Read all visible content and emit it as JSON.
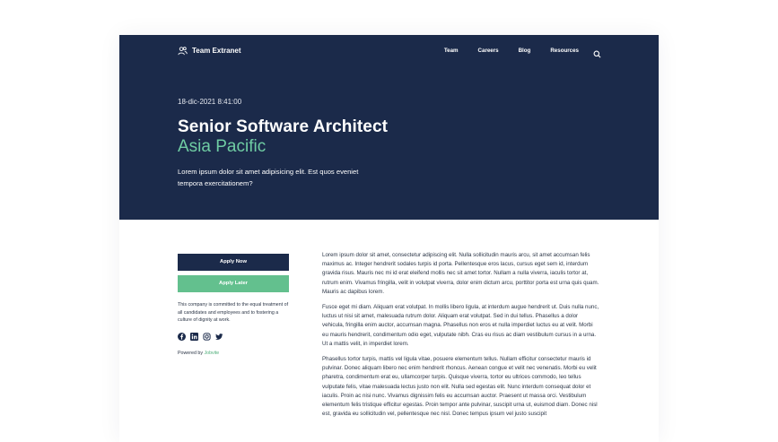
{
  "header": {
    "brand": "Team Extranet",
    "nav": [
      "Team",
      "Careers",
      "Blog",
      "Resources"
    ],
    "search_icon": "search-icon"
  },
  "hero": {
    "date": "18-dic-2021 8:41:00",
    "title": "Senior Software Architect",
    "subtitle": "Asia Pacific",
    "lead": "Lorem ipsum dolor sit amet adipisicing elit. Est quos eveniet tempora exercitationem?",
    "bg_color": "#1b2a4a",
    "accent_color": "#6fcca3"
  },
  "sidebar": {
    "apply_now": "Apply Now",
    "apply_later": "Apply Later",
    "eeo": "This company is committed to the equal treatment of all candidates and employees and to fostering a culture of dignity at work.",
    "social_icons": [
      "facebook-icon",
      "linkedin-icon",
      "instagram-icon",
      "twitter-icon"
    ],
    "powered_prefix": "Powered by",
    "powered_link": "Jobvite"
  },
  "content": {
    "paragraphs": [
      "Lorem ipsum dolor sit amet, consectetur adipiscing elit. Nulla sollicitudin mauris arcu, sit amet accumsan felis maximus ac. Integer hendrerit sodales turpis id porta. Pellentesque eros lacus, cursus eget sem id, interdum gravida risus. Mauris nec mi id erat eleifend mollis nec sit amet tortor. Nullam a nulla viverra, iaculis tortor at, rutrum enim. Vivamus fringilla, velit in volutpat viverra, dolor enim dictum arcu, porttitor porta est urna quis quam. Mauris ac dapibus lorem.",
      "Fusce eget mi diam. Aliquam erat volutpat. In mollis libero ligula, at interdum augue hendrerit ut. Duis nulla nunc, luctus ut nisi sit amet, malesuada rutrum dolor. Aliquam erat volutpat. Sed in dui tellus. Phasellus a dolor vehicula, fringilla enim auctor, accumsan magna. Phasellus non eros et nulla imperdiet luctus eu at velit. Morbi eu mauris hendrerit, condimentum odio eget, vulputate nibh. Cras eu risus ac diam vestibulum cursus in a urna. Ut a mattis velit, in imperdiet lorem.",
      "Phasellus tortor turpis, mattis vel ligula vitae, posuere elementum tellus. Nullam efficitur consectetur mauris id pulvinar. Donec aliquam libero nec enim hendrerit rhoncus. Aenean congue et velit nec venenatis. Morbi eu velit pharetra, condimentum erat eu, ullamcorper turpis. Quisque viverra, tortor eu ultrices commodo, leo tellus vulputate felis, vitae malesuada lectus justo non elit. Nulla sed egestas elit. Nunc interdum consequat dolor et iaculis. Proin ac nisi nunc. Vivamus dignissim felis eu accumsan auctor. Praesent ut massa orci. Vestibulum elementum felis tristique efficitur egestas. Proin tempor ante pulvinar, suscipit urna ut, euismod diam. Donec nisl est, gravida eu sollicitudin vel, pellentesque nec nisl. Donec tempus ipsum vel justo suscipit"
    ]
  }
}
